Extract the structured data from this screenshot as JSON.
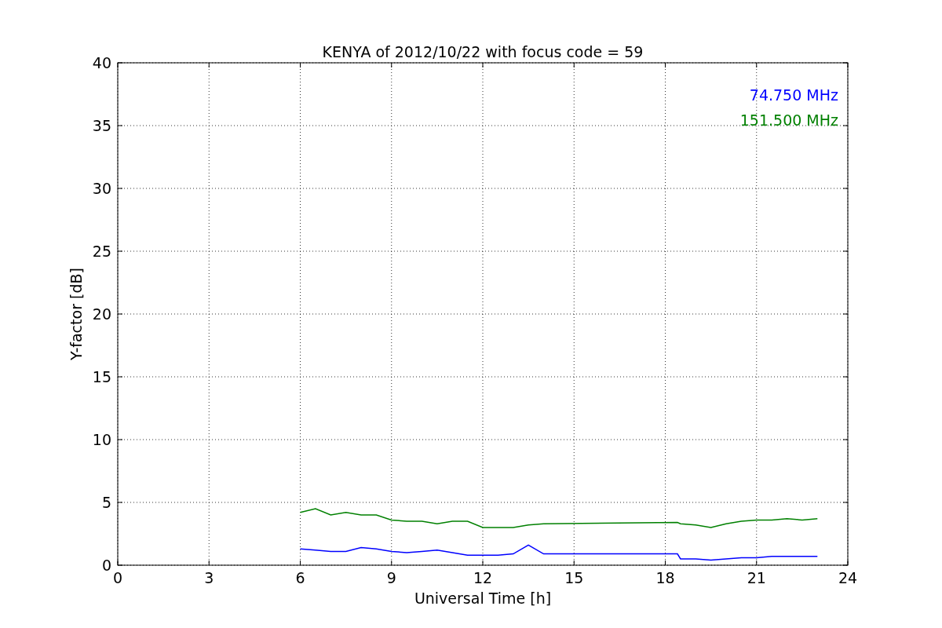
{
  "chart_data": {
    "type": "line",
    "title": "KENYA of 2012/10/22 with focus code = 59",
    "xlabel": "Universal Time [h]",
    "ylabel": "Y-factor [dB]",
    "x": [
      6,
      6.5,
      7,
      7.5,
      8,
      8.5,
      9,
      9.5,
      10,
      10.5,
      11,
      11.5,
      12,
      12.5,
      13,
      13.5,
      14,
      18.4,
      18.5,
      19,
      19.5,
      20,
      20.5,
      21,
      21.5,
      22,
      22.5,
      23
    ],
    "series": [
      {
        "name": "74.750 MHz",
        "color": "#0000ff",
        "values": [
          1.3,
          1.2,
          1.1,
          1.1,
          1.4,
          1.3,
          1.1,
          1.0,
          1.1,
          1.2,
          1.0,
          0.8,
          0.8,
          0.8,
          0.9,
          1.6,
          0.9,
          0.9,
          0.5,
          0.5,
          0.4,
          0.5,
          0.6,
          0.6,
          0.7,
          0.7,
          0.7,
          0.7
        ]
      },
      {
        "name": "151.500 MHz",
        "color": "#008000",
        "values": [
          4.2,
          4.5,
          4.0,
          4.2,
          4.0,
          4.0,
          3.6,
          3.5,
          3.5,
          3.3,
          3.5,
          3.5,
          3.0,
          3.0,
          3.0,
          3.2,
          3.3,
          3.4,
          3.3,
          3.2,
          3.0,
          3.3,
          3.5,
          3.6,
          3.6,
          3.7,
          3.6,
          3.7
        ]
      }
    ],
    "grid": true,
    "xlim": [
      0,
      24
    ],
    "ylim": [
      0,
      40
    ],
    "xticks": [
      0,
      3,
      6,
      9,
      12,
      15,
      18,
      21,
      24
    ],
    "yticks": [
      0,
      5,
      10,
      15,
      20,
      25,
      30,
      35,
      40
    ]
  }
}
